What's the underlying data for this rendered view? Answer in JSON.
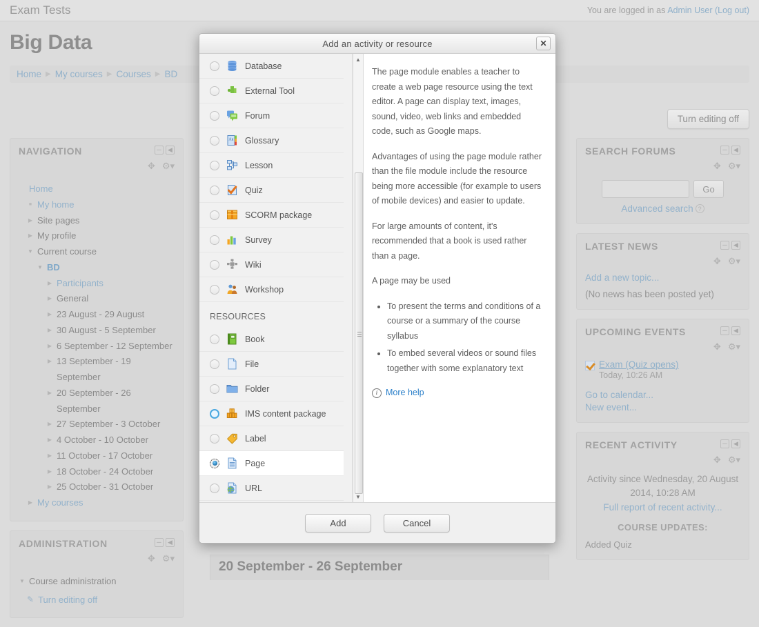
{
  "header": {
    "site_name": "Exam Tests",
    "login_prefix": "You are logged in as",
    "user_name": "Admin User",
    "logout_label": "(Log out)"
  },
  "course": {
    "title": "Big Data",
    "turn_editing_label": "Turn editing off"
  },
  "breadcrumb": [
    {
      "label": "Home"
    },
    {
      "label": "My courses"
    },
    {
      "label": "Courses"
    },
    {
      "label": "BD"
    }
  ],
  "navigation_block": {
    "title": "NAVIGATION",
    "items": [
      {
        "label": "Home",
        "indent": 0,
        "arrow": "none",
        "link": true
      },
      {
        "label": "My home",
        "indent": 1,
        "arrow": "sq",
        "link": true
      },
      {
        "label": "Site pages",
        "indent": 1,
        "arrow": "right",
        "link": false
      },
      {
        "label": "My profile",
        "indent": 1,
        "arrow": "right",
        "link": false
      },
      {
        "label": "Current course",
        "indent": 1,
        "arrow": "down",
        "link": false
      },
      {
        "label": "BD",
        "indent": 2,
        "arrow": "down",
        "link": false,
        "bd": true
      },
      {
        "label": "Participants",
        "indent": 3,
        "arrow": "right",
        "link": true
      },
      {
        "label": "General",
        "indent": 3,
        "arrow": "right",
        "link": false
      },
      {
        "label": "23 August - 29 August",
        "indent": 3,
        "arrow": "right",
        "link": false
      },
      {
        "label": "30 August - 5 September",
        "indent": 3,
        "arrow": "right",
        "link": false
      },
      {
        "label": "6 September - 12 September",
        "indent": 3,
        "arrow": "right",
        "link": false
      },
      {
        "label": "13 September - 19 September",
        "indent": 3,
        "arrow": "right",
        "link": false
      },
      {
        "label": "20 September - 26 September",
        "indent": 3,
        "arrow": "right",
        "link": false
      },
      {
        "label": "27 September - 3 October",
        "indent": 3,
        "arrow": "right",
        "link": false
      },
      {
        "label": "4 October - 10 October",
        "indent": 3,
        "arrow": "right",
        "link": false
      },
      {
        "label": "11 October - 17 October",
        "indent": 3,
        "arrow": "right",
        "link": false
      },
      {
        "label": "18 October - 24 October",
        "indent": 3,
        "arrow": "right",
        "link": false
      },
      {
        "label": "25 October - 31 October",
        "indent": 3,
        "arrow": "right",
        "link": false
      },
      {
        "label": "My courses",
        "indent": 1,
        "arrow": "right",
        "link": true
      }
    ]
  },
  "administration_block": {
    "title": "ADMINISTRATION",
    "root_label": "Course administration",
    "turn_editing_off": "Turn editing off"
  },
  "search_forums_block": {
    "title": "SEARCH FORUMS",
    "input_value": "",
    "input_placeholder": "",
    "go_label": "Go",
    "advanced_search_label": "Advanced search"
  },
  "latest_news_block": {
    "title": "LATEST NEWS",
    "add_topic_label": "Add a new topic...",
    "empty_text": "(No news has been posted yet)"
  },
  "upcoming_events_block": {
    "title": "UPCOMING EVENTS",
    "event_name": "Exam (Quiz opens)",
    "event_time": "Today, 10:26 AM",
    "go_to_calendar_label": "Go to calendar...",
    "new_event_label": "New event..."
  },
  "recent_activity_block": {
    "title": "RECENT ACTIVITY",
    "activity_since": "Activity since Wednesday, 20 August 2014, 10:28 AM",
    "full_report_label": "Full report of recent activity...",
    "course_updates_label": "COURSE UPDATES:",
    "update_item": "Added Quiz"
  },
  "section": {
    "title": "20 September - 26 September"
  },
  "modal": {
    "title": "Add an activity or resource",
    "close_label": "✕",
    "add_label": "Add",
    "cancel_label": "Cancel",
    "activities": [
      {
        "label": "Database",
        "icon": "database-icon",
        "state": "normal"
      },
      {
        "label": "External Tool",
        "icon": "external-tool-icon",
        "state": "normal"
      },
      {
        "label": "Forum",
        "icon": "forum-icon",
        "state": "normal"
      },
      {
        "label": "Glossary",
        "icon": "glossary-icon",
        "state": "normal"
      },
      {
        "label": "Lesson",
        "icon": "lesson-icon",
        "state": "normal"
      },
      {
        "label": "Quiz",
        "icon": "quiz-icon",
        "state": "normal"
      },
      {
        "label": "SCORM package",
        "icon": "scorm-icon",
        "state": "normal"
      },
      {
        "label": "Survey",
        "icon": "survey-icon",
        "state": "normal"
      },
      {
        "label": "Wiki",
        "icon": "wiki-icon",
        "state": "normal"
      },
      {
        "label": "Workshop",
        "icon": "workshop-icon",
        "state": "normal"
      }
    ],
    "resources_heading": "RESOURCES",
    "resources": [
      {
        "label": "Book",
        "icon": "book-icon",
        "state": "normal"
      },
      {
        "label": "File",
        "icon": "file-icon",
        "state": "normal"
      },
      {
        "label": "Folder",
        "icon": "folder-icon",
        "state": "normal"
      },
      {
        "label": "IMS content package",
        "icon": "ims-icon",
        "state": "hover"
      },
      {
        "label": "Label",
        "icon": "label-icon",
        "state": "normal"
      },
      {
        "label": "Page",
        "icon": "page-icon",
        "state": "checked"
      },
      {
        "label": "URL",
        "icon": "url-icon",
        "state": "normal"
      }
    ],
    "help": {
      "paragraphs": [
        "The page module enables a teacher to create a web page resource using the text editor. A page can display text, images, sound, video, web links and embedded code, such as Google maps.",
        "Advantages of using the page module rather than the file module include the resource being more accessible (for example to users of mobile devices) and easier to update.",
        "For large amounts of content, it's recommended that a book is used rather than a page.",
        "A page may be used"
      ],
      "bullets": [
        "To present the terms and conditions of a course or a summary of the course syllabus",
        "To embed several videos or sound files together with some explanatory text"
      ],
      "more_help_label": "More help"
    }
  },
  "colors": {
    "page_bg": "#dcdcdc",
    "block_bg": "#d7d7d7",
    "link": "#93b2cb",
    "modal_bg": "#f2f2f2",
    "help_link": "#2a7fc9",
    "hover_radio": "#49a8e0"
  }
}
